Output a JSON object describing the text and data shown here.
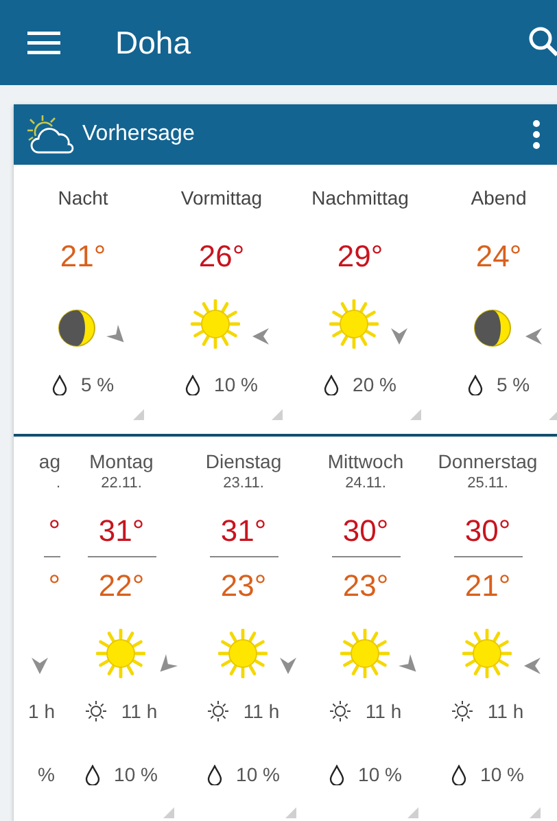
{
  "app_bar": {
    "title": "Doha"
  },
  "card": {
    "title": "Vorhersage"
  },
  "periods": [
    {
      "label": "Nacht",
      "temp": "21°",
      "color": "#d9601c",
      "kind": "moon",
      "wind": {
        "kind": "nw"
      },
      "rain": "5 %"
    },
    {
      "label": "Vormittag",
      "temp": "26°",
      "color": "#c8141e",
      "kind": "sun",
      "wind": {
        "kind": "e"
      },
      "rain": "10 %"
    },
    {
      "label": "Nachmittag",
      "temp": "29°",
      "color": "#c8141e",
      "kind": "sun",
      "wind": {
        "kind": "n"
      },
      "rain": "20 %"
    },
    {
      "label": "Abend",
      "temp": "24°",
      "color": "#d9601c",
      "kind": "moon",
      "wind": {
        "kind": "e"
      },
      "rain": "5 %"
    }
  ],
  "days_partial": {
    "day": "ag",
    "date": ".",
    "high": "°",
    "low": "°",
    "wind": {
      "kind": "n"
    },
    "sunshine": "1 h",
    "rain": "%"
  },
  "days": [
    {
      "day": "Montag",
      "date": "22.11.",
      "high": "31°",
      "low": "22°",
      "kind": "sun",
      "wind": {
        "kind": "ne"
      },
      "sunshine": "11 h",
      "rain": "10 %"
    },
    {
      "day": "Dienstag",
      "date": "23.11.",
      "high": "31°",
      "low": "23°",
      "kind": "sun",
      "wind": {
        "kind": "n"
      },
      "sunshine": "11 h",
      "rain": "10 %"
    },
    {
      "day": "Mittwoch",
      "date": "24.11.",
      "high": "30°",
      "low": "23°",
      "kind": "sun",
      "wind": {
        "kind": "nw"
      },
      "sunshine": "11 h",
      "rain": "10 %"
    },
    {
      "day": "Donnerstag",
      "date": "25.11.",
      "high": "30°",
      "low": "21°",
      "kind": "sun",
      "wind": {
        "kind": "e"
      },
      "sunshine": "11 h",
      "rain": "10 %"
    }
  ]
}
